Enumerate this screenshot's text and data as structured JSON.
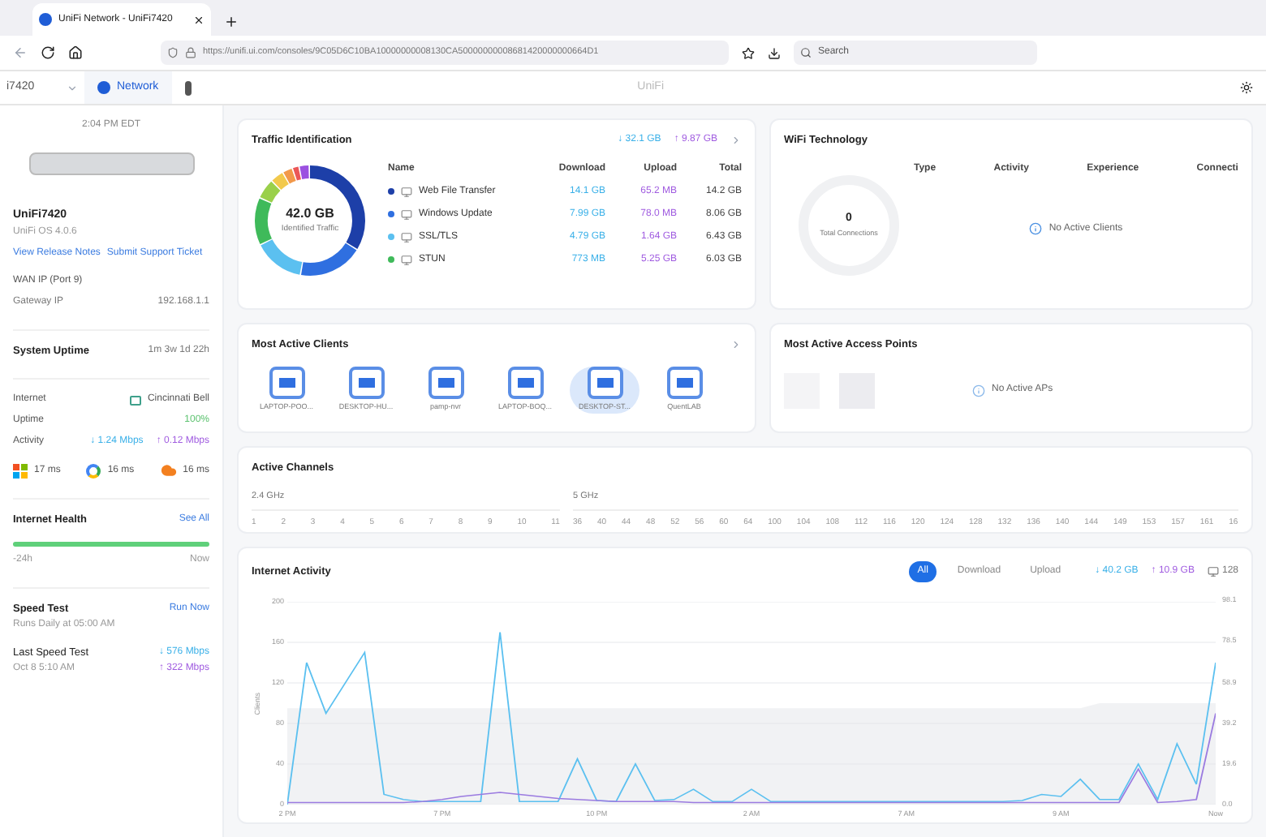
{
  "browser": {
    "tab_title": "UniFi Network - UniFi7420",
    "url": "https://unifi.ui.com/consoles/9C05D6C10BA10000000008130CA50000000008681420000000664D1",
    "search_placeholder": "Search"
  },
  "app_bar": {
    "console": "i7420",
    "tabs": [
      {
        "label": "Network",
        "selected": true
      }
    ],
    "title": "UniFi"
  },
  "sidebar": {
    "time": "2:04 PM EDT",
    "device": "UniFi7420",
    "os": "UniFi OS 4.0.6",
    "links": [
      "View Release Notes",
      "Submit Support Ticket"
    ],
    "wan": "WAN IP (Port 9)",
    "gateway_label": "Gateway IP",
    "gateway": "192.168.1.1",
    "uptime_label": "System Uptime",
    "uptime": "1m 3w 1d 22h",
    "isp_label": "Internet",
    "isp": "Cincinnati Bell",
    "isp_uptime_label": "Uptime",
    "isp_uptime": "100%",
    "activity_label": "Activity",
    "activity_down": "↓ 1.24 Mbps",
    "activity_up": "↑ 0.12 Mbps",
    "latencies": [
      {
        "kind": "windows",
        "value": "17 ms"
      },
      {
        "kind": "google",
        "value": "16 ms"
      },
      {
        "kind": "cloud",
        "value": "16 ms"
      }
    ],
    "health_title": "Internet Health",
    "health_link": "See All",
    "health_start": "-24h",
    "health_end": "Now",
    "speed_title": "Speed Test",
    "speed_link": "Run Now",
    "speed_schedule": "Runs Daily at 05:00 AM",
    "last_title": "Last Speed Test",
    "last_date": "Oct 8 5:10 AM",
    "last_down": "↓ 576 Mbps",
    "last_up": "↑ 322 Mbps"
  },
  "traffic": {
    "title": "Traffic Identification",
    "download_total": "↓ 32.1 GB",
    "upload_total": "↑ 9.87 GB",
    "center_value": "42.0 GB",
    "center_label": "Identified Traffic",
    "columns": [
      "Name",
      "Download",
      "Upload",
      "Total"
    ],
    "rows": [
      {
        "color": "#1d3fa8",
        "name": "Web File Transfer",
        "download": "14.1 GB",
        "upload": "65.2 MB",
        "total": "14.2 GB"
      },
      {
        "color": "#2f6fe0",
        "name": "Windows Update",
        "download": "7.99 GB",
        "upload": "78.0 MB",
        "total": "8.06 GB"
      },
      {
        "color": "#5bc0f0",
        "name": "SSL/TLS",
        "download": "4.79 GB",
        "upload": "1.64 GB",
        "total": "6.43 GB"
      },
      {
        "color": "#3fba5a",
        "name": "STUN",
        "download": "773 MB",
        "upload": "5.25 GB",
        "total": "6.03 GB"
      }
    ]
  },
  "clients": {
    "title": "Most Active Clients",
    "items": [
      {
        "name": "LAPTOP-POO...",
        "selected": false
      },
      {
        "name": "DESKTOP-HU...",
        "selected": false
      },
      {
        "name": "pamp-nvr",
        "selected": false
      },
      {
        "name": "LAPTOP-BOQ...",
        "selected": false
      },
      {
        "name": "DESKTOP-ST...",
        "selected": true
      },
      {
        "name": "QuentLAB",
        "selected": false
      }
    ]
  },
  "wifi": {
    "title": "WiFi Technology",
    "columns": [
      "Type",
      "Activity",
      "Experience",
      "Connecti"
    ],
    "total": "0",
    "total_label": "Total Connections",
    "empty": "No Active Clients"
  },
  "access_points": {
    "title": "Most Active Access Points",
    "empty": "No Active APs"
  },
  "channels": {
    "title": "Active Channels",
    "bands": [
      {
        "label": "2.4 GHz",
        "channels": [
          "1",
          "2",
          "3",
          "4",
          "5",
          "6",
          "7",
          "8",
          "9",
          "10",
          "11"
        ]
      },
      {
        "label": "5 GHz",
        "channels": [
          "36",
          "40",
          "44",
          "48",
          "52",
          "56",
          "60",
          "64",
          "100",
          "104",
          "108",
          "112",
          "116",
          "120",
          "124",
          "128",
          "132",
          "136",
          "140",
          "144",
          "149",
          "153",
          "157",
          "161",
          "16"
        ]
      }
    ]
  },
  "activity": {
    "title": "Internet Activity",
    "filters": [
      {
        "label": "All",
        "selected": true
      },
      {
        "label": "Download",
        "selected": false
      },
      {
        "label": "Upload",
        "selected": false
      }
    ],
    "download": "↓ 40.2 GB",
    "upload": "↑ 10.9 GB",
    "clients": "128",
    "y2_ticks": [
      "98.1",
      "78.5",
      "58.9",
      "39.2",
      "19.6",
      "0.0"
    ],
    "chart_data": {
      "type": "line",
      "grid": true,
      "ylabel": "Clients",
      "categories": [
        "2 PM",
        null,
        null,
        null,
        null,
        null,
        null,
        null,
        "7 PM",
        null,
        null,
        null,
        null,
        null,
        null,
        null,
        "10 PM",
        null,
        null,
        null,
        null,
        null,
        null,
        null,
        "2 AM",
        null,
        null,
        null,
        null,
        null,
        null,
        null,
        "7 AM",
        null,
        null,
        null,
        null,
        null,
        null,
        null,
        "9 AM",
        null,
        null,
        null,
        null,
        null,
        null,
        null,
        "Now"
      ],
      "ylim": [
        0,
        200
      ],
      "yticks": [
        200,
        160,
        120,
        80,
        40,
        0
      ],
      "series": [
        {
          "type": "area",
          "color": "#e3e5ea",
          "values": [
            95,
            95,
            95,
            95,
            95,
            95,
            95,
            95,
            95,
            95,
            95,
            95,
            95,
            95,
            95,
            95,
            95,
            95,
            95,
            95,
            95,
            95,
            95,
            95,
            95,
            95,
            95,
            95,
            95,
            95,
            95,
            95,
            95,
            95,
            95,
            95,
            95,
            95,
            95,
            95,
            95,
            95,
            100,
            100,
            100,
            100,
            100,
            100,
            100
          ]
        },
        {
          "color": "#5bc0f0",
          "values": [
            0,
            140,
            90,
            120,
            150,
            10,
            5,
            3,
            3,
            3,
            3,
            170,
            3,
            3,
            3,
            45,
            4,
            3,
            40,
            4,
            5,
            15,
            3,
            3,
            15,
            3,
            3,
            3,
            3,
            3,
            3,
            3,
            3,
            3,
            3,
            3,
            3,
            3,
            4,
            10,
            8,
            25,
            5,
            5,
            40,
            5,
            60,
            20,
            140
          ]
        },
        {
          "color": "#9b7be0",
          "values": [
            2,
            2,
            2,
            2,
            2,
            2,
            2,
            3,
            5,
            8,
            10,
            12,
            10,
            8,
            6,
            5,
            4,
            3,
            3,
            3,
            3,
            2,
            2,
            2,
            2,
            2,
            2,
            2,
            2,
            2,
            2,
            2,
            2,
            2,
            2,
            2,
            2,
            2,
            2,
            2,
            2,
            2,
            2,
            2,
            35,
            2,
            3,
            5,
            90
          ]
        }
      ]
    }
  }
}
